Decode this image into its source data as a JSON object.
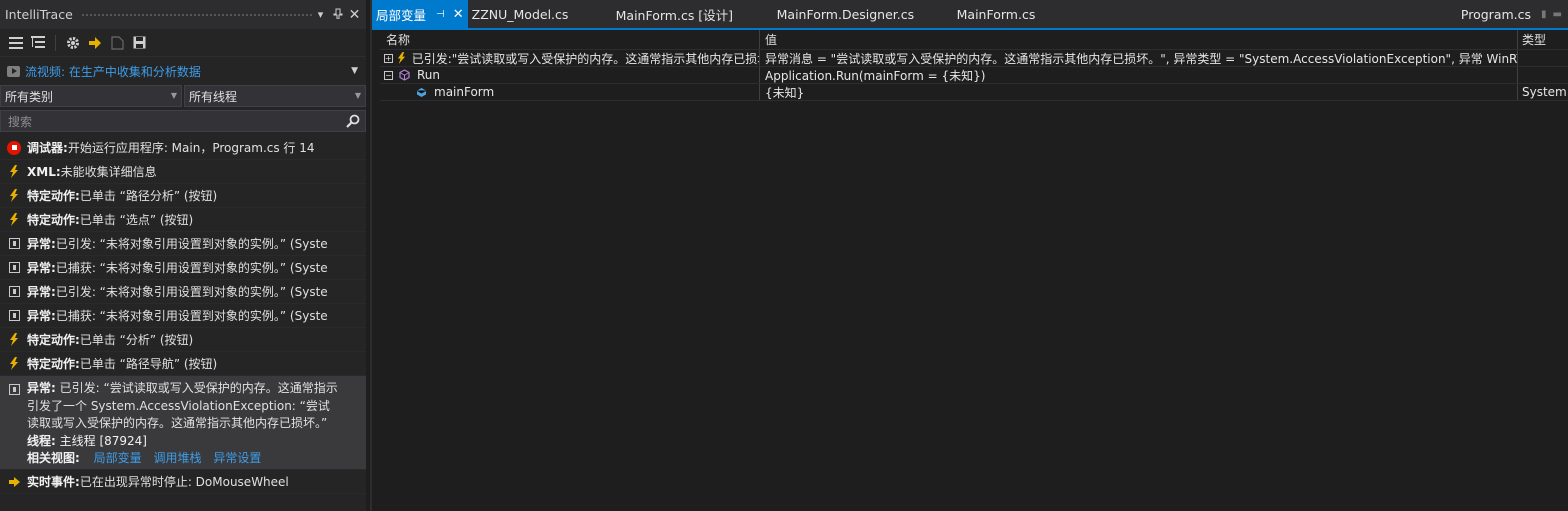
{
  "left_panel": {
    "title": "IntelliTrace",
    "title_buttons": {
      "dropdown": "▾",
      "pin": "⊓",
      "close": "✕"
    },
    "stream_link": "流视频: 在生产中收集和分析数据",
    "category_filter": "所有类别",
    "thread_filter": "所有线程",
    "search_placeholder": "搜索",
    "events": [
      {
        "icon": "stop-icon",
        "label": "调试器:",
        "text": " 开始运行应用程序: Main，Program.cs 行 14"
      },
      {
        "icon": "lightning-icon",
        "label": "XML:",
        "text": " 未能收集详细信息"
      },
      {
        "icon": "lightning-icon",
        "label": "特定动作:",
        "text": " 已单击 “路径分析” (按钮)"
      },
      {
        "icon": "lightning-icon",
        "label": "特定动作:",
        "text": " 已单击 “选点” (按钮)"
      },
      {
        "icon": "exception-icon",
        "label": "异常:",
        "text": " 已引发: “未将对象引用设置到对象的实例。” (Syste"
      },
      {
        "icon": "exception-icon",
        "label": "异常:",
        "text": " 已捕获: “未将对象引用设置到对象的实例。” (Syste"
      },
      {
        "icon": "exception-icon",
        "label": "异常:",
        "text": " 已引发: “未将对象引用设置到对象的实例。” (Syste"
      },
      {
        "icon": "exception-icon",
        "label": "异常:",
        "text": " 已捕获: “未将对象引用设置到对象的实例。” (Syste"
      },
      {
        "icon": "lightning-icon",
        "label": "特定动作:",
        "text": " 已单击 “分析” (按钮)"
      },
      {
        "icon": "lightning-icon",
        "label": "特定动作:",
        "text": " 已单击 “路径导航” (按钮)"
      }
    ],
    "selected_event": {
      "label": "异常:",
      "text": " 已引发: “尝试读取或写入受保护的内存。这通常指示引发了一个 System.AccessViolationException: “尝试读取或写入受保护的内存。这通常指示其他内存已损坏。”",
      "thread_label": "线程:",
      "thread_value": " 主线程 [87924]",
      "related_label": "相关视图:",
      "related_links": [
        "局部变量",
        "调用堆栈",
        "异常设置"
      ]
    },
    "live_event": {
      "label": "实时事件:",
      "text": " 已在出现异常时停止: DoMouseWheel"
    }
  },
  "tabs": [
    {
      "label": "局部变量",
      "active": true
    },
    {
      "label": "ZZNU_Model.cs"
    },
    {
      "label": "MainForm.cs [设计]"
    },
    {
      "label": "MainForm.Designer.cs"
    },
    {
      "label": "MainForm.cs"
    }
  ],
  "right_tab": "Program.cs",
  "locals": {
    "columns": {
      "name": "名称",
      "value": "值",
      "type": "类型"
    },
    "rows": [
      {
        "expander": "+",
        "icon": "lightning-icon",
        "name": "已引发:\"尝试读取或写入受保护的内存。这通常指示其他内存已损坏",
        "value": "异常消息 = \"尝试读取或写入受保护的内存。这通常指示其他内存已损坏。\", 异常类型 = \"System.AccessViolationException\", 异常 WinRT 数据 =",
        "type": ""
      },
      {
        "expander": "−",
        "icon": "method-icon",
        "name": "Run",
        "value": "Application.Run(mainForm = {未知})",
        "type": ""
      },
      {
        "expander": "",
        "icon": "field-icon",
        "name": "mainForm",
        "value": "{未知}",
        "type": "System.Windows.Forms.Form"
      }
    ]
  },
  "colors": {
    "accent": "#007acc",
    "link": "#3e9ce8",
    "stop": "#e51400",
    "lightning": "#e8b100"
  }
}
